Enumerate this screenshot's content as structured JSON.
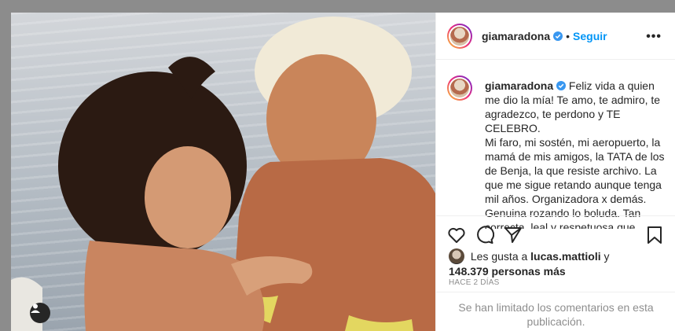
{
  "post": {
    "username": "giamaradona",
    "follow_label": "Seguir",
    "separator": "•",
    "more_label": "•••",
    "caption_lines": [
      "Feliz vida a quien",
      "me dio la mía! Te amo, te admiro, te",
      "agradezco, te perdono y TE",
      "CELEBRO.",
      "Mi faro, mi sostén, mi aeropuerto, la",
      "mamá de mis amigos, la TATA de los",
      "de Benja, la que resiste archivo. La",
      "que me sigue retando aunque tenga",
      "mil años. Organizadora x demás.",
      "Genuina rozando lo boluda. Tan",
      "correcta, leal y respetuosa que"
    ],
    "likes_prefix": "Les gusta a",
    "likes_user": "lucas.mattioli",
    "likes_join": "y",
    "likes_count": "148.379 personas más",
    "time_label": "HACE 2 DÍAS",
    "comments_limited": "Se han limitado los comentarios en esta publicación."
  },
  "icons": {
    "verified": "verified-badge-icon",
    "like": "heart-icon",
    "comment": "comment-icon",
    "share": "paper-plane-icon",
    "save": "bookmark-icon",
    "tags": "user-tag-icon"
  },
  "colors": {
    "accent": "#0095f6",
    "text": "#262626",
    "muted": "#8e8e8e",
    "border": "#efefef"
  }
}
